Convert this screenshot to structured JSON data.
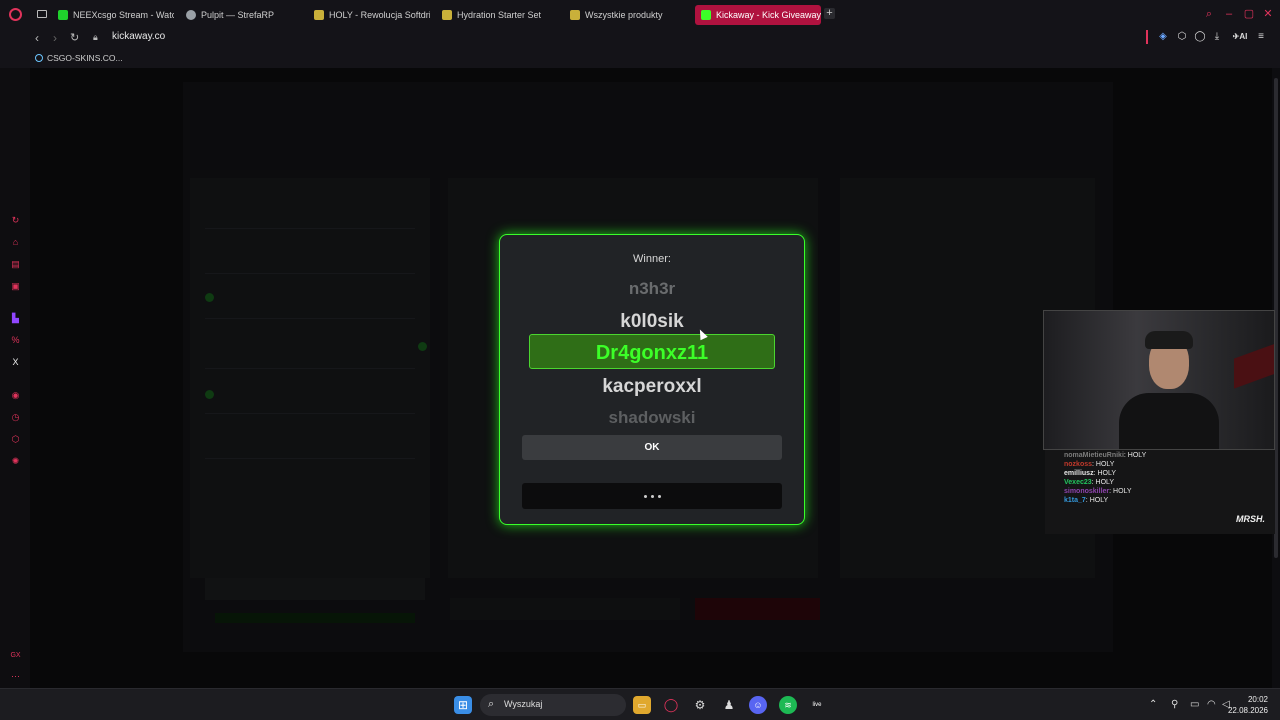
{
  "browser": {
    "tabs": [
      {
        "label": "NEEXcsgo Stream - Watch",
        "icon": "kick-icon",
        "color": "#1fd12c"
      },
      {
        "label": "Pulpit — StrefaRP",
        "icon": "gear-icon",
        "color": "#9aa0a6"
      },
      {
        "label": "HOLY - Rewolucja Softdrin",
        "icon": "holy-icon",
        "color": "#c9b03a"
      },
      {
        "label": "Hydration Starter Set",
        "icon": "holy-icon",
        "color": "#c9b03a"
      },
      {
        "label": "Wszystkie produkty",
        "icon": "holy-icon",
        "color": "#c9b03a"
      },
      {
        "label": "Kickaway - Kick Giveaway",
        "icon": "kickaway-icon",
        "color": "#3cff28"
      }
    ],
    "new_tab": "+",
    "url": "kickaway.co",
    "bookmark": "CSGO-SKINS.CO..."
  },
  "modal": {
    "title": "Winner:",
    "names": [
      "n3h3r",
      "k0l0sik",
      "Dr4gonxz11",
      "kacperoxxl",
      "shadowski"
    ],
    "winner": "Dr4gonxz11",
    "ok_label": "OK"
  },
  "chat": {
    "messages": [
      {
        "user": "nomaMietieuRniki",
        "msg": "HOLY",
        "color": "#7c7c7c"
      },
      {
        "user": "nozkoss",
        "msg": "HOLY",
        "color": "#c0392b"
      },
      {
        "user": "emilliusz",
        "msg": "HOLY",
        "color": "#e6e6e6"
      },
      {
        "user": "Vexec23",
        "msg": "HOLY",
        "color": "#22c55e"
      },
      {
        "user": "simonoskiller",
        "msg": "HOLY",
        "color": "#8e44ad"
      },
      {
        "user": "k1ta_7",
        "msg": "HOLY",
        "color": "#3498db"
      }
    ],
    "logo": "MRSH."
  },
  "taskbar": {
    "search_label": "Wyszukaj",
    "time": "20:02",
    "date": "22.08.2026",
    "live_label": "live"
  },
  "colors": {
    "accent": "#3cff28",
    "browser_accent": "#e0335b",
    "active_tab": "#b0123f"
  }
}
